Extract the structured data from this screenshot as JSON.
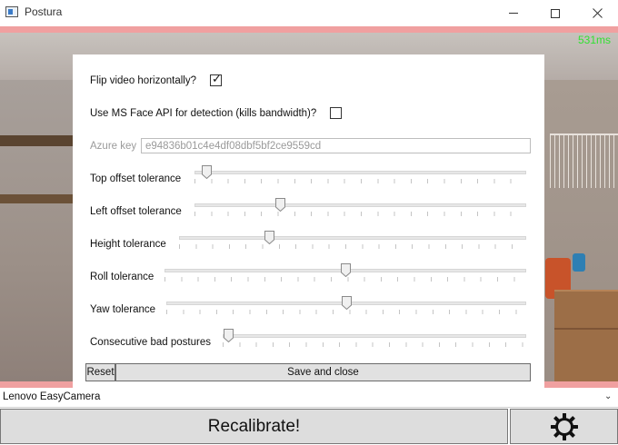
{
  "window": {
    "title": "Postura",
    "controls": {
      "minimize": "minimize-icon",
      "maximize": "maximize-icon",
      "close": "close-icon"
    }
  },
  "camera_feed": {
    "latency_label": "531ms",
    "latency_color": "#32e032",
    "border_color": "#f0a0a0"
  },
  "settings": {
    "flip_label": "Flip video horizontally?",
    "flip_checked": true,
    "face_api_label": "Use MS Face API for detection (kills bandwidth)?",
    "face_api_checked": false,
    "azure_key_label": "Azure key",
    "azure_key_value": "e94836b01c4e4df08dbf5bf2ce9559cd",
    "sliders": [
      {
        "label": "Top offset tolerance",
        "value_fraction": 0.02
      },
      {
        "label": "Left offset tolerance",
        "value_fraction": 0.25
      },
      {
        "label": "Height tolerance",
        "value_fraction": 0.25
      },
      {
        "label": "Roll tolerance",
        "value_fraction": 0.5
      },
      {
        "label": "Yaw tolerance",
        "value_fraction": 0.5
      },
      {
        "label": "Consecutive bad postures",
        "value_fraction": 0.0
      }
    ],
    "reset_label": "Reset",
    "save_label": "Save and close"
  },
  "camera_select": {
    "selected": "Lenovo EasyCamera",
    "icon": "chevron-down-icon"
  },
  "bottom_bar": {
    "recalibrate_label": "Recalibrate!",
    "settings_icon": "gear-icon"
  }
}
